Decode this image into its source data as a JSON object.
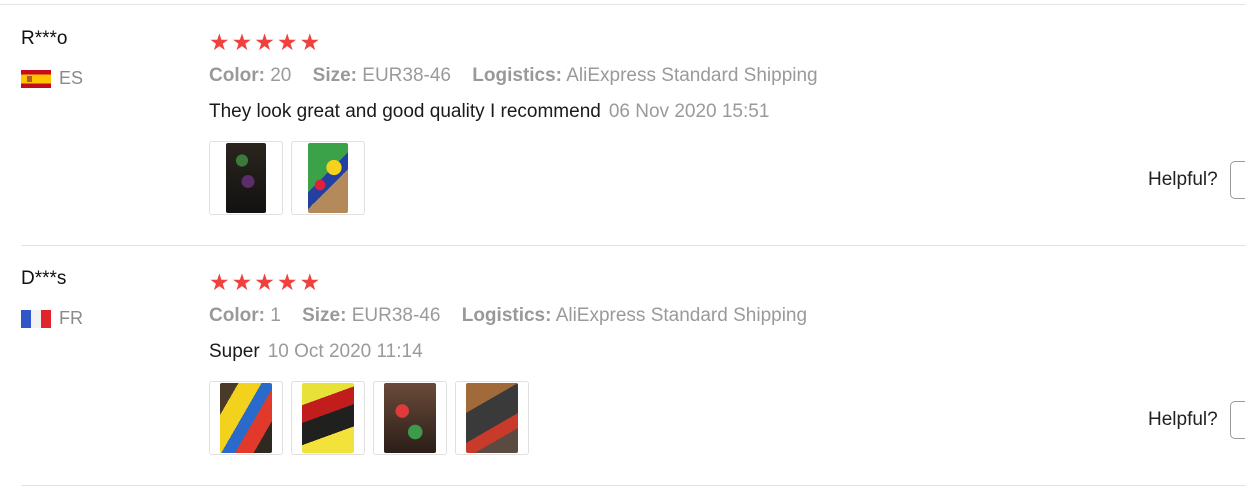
{
  "reviews": [
    {
      "user": "R***o",
      "country": "ES",
      "rating": 5,
      "color_label": "Color:",
      "color_value": "20",
      "size_label": "Size:",
      "size_value": "EUR38-46",
      "logistics_label": "Logistics:",
      "logistics_value": "AliExpress Standard Shipping",
      "text": "They look great and good quality I recommend",
      "date": "06 Nov 2020 15:51",
      "helpful_label": "Helpful?",
      "photos": 2
    },
    {
      "user": "D***s",
      "country": "FR",
      "rating": 5,
      "color_label": "Color:",
      "color_value": "1",
      "size_label": "Size:",
      "size_value": "EUR38-46",
      "logistics_label": "Logistics:",
      "logistics_value": "AliExpress Standard Shipping",
      "text": "Super",
      "date": "10 Oct 2020 11:14",
      "helpful_label": "Helpful?",
      "photos": 4
    }
  ],
  "colors": {
    "star": "#f0413f",
    "muted": "#9a9a9a"
  }
}
